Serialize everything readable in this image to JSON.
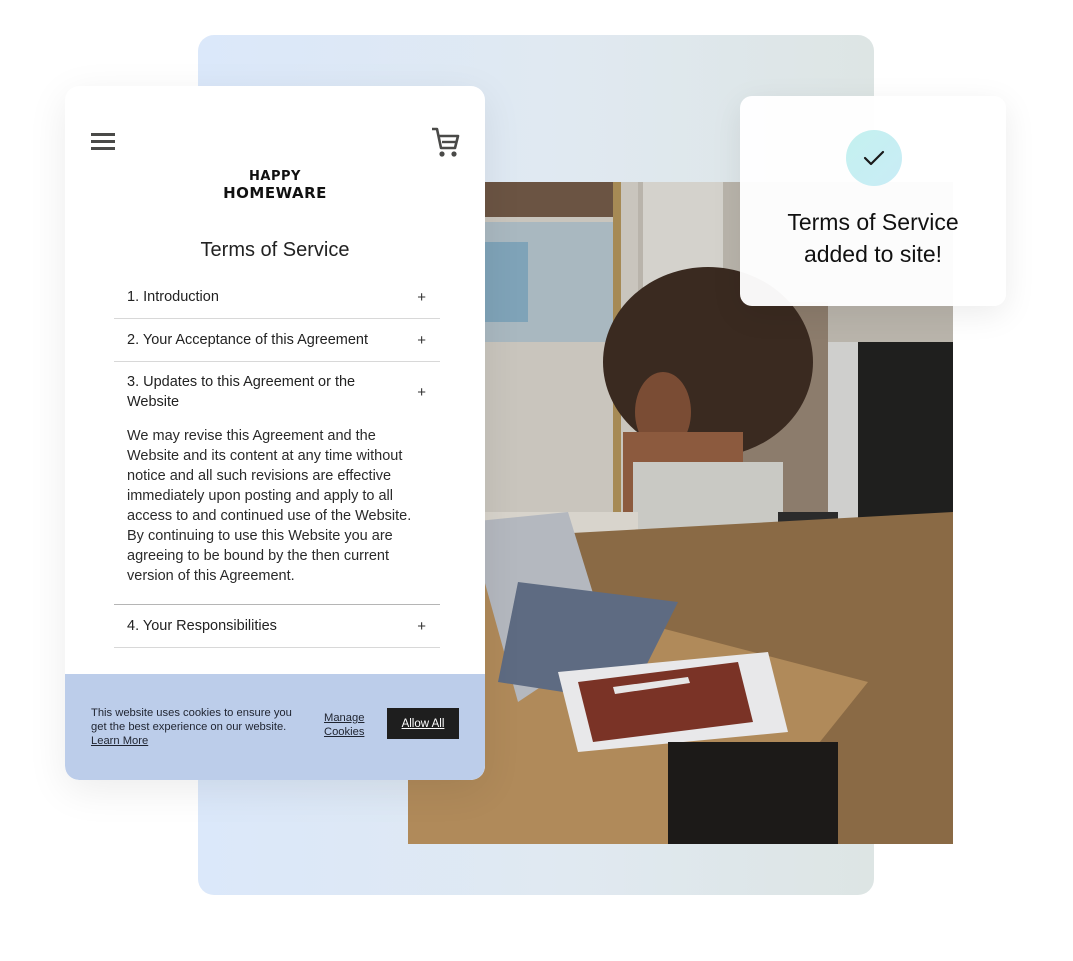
{
  "phone": {
    "menu_icon": "hamburger-menu-icon",
    "cart_icon": "shopping-cart-icon",
    "logo": {
      "line1": "Happy",
      "line2": "Homeware"
    },
    "page_title": "Terms of Service",
    "accordion": [
      {
        "title": "1. Introduction",
        "toggle": "+",
        "open": false
      },
      {
        "title": "2. Your Acceptance of this Agreement",
        "toggle": "+",
        "open": false
      },
      {
        "title": "3. Updates to this Agreement or the Website",
        "toggle": "+",
        "open": true,
        "body": "We may revise this Agreement and the Website and its content at any time without notice and all such revisions are effective immediately upon posting and apply to all access to and continued use of the Website. By continuing to use this Website you are agreeing to be bound by the then current version of this Agreement."
      },
      {
        "title": "4. Your Responsibilities",
        "toggle": "+",
        "open": false
      }
    ],
    "cookie_banner": {
      "message": "This website uses cookies to ensure you get the best experience on our website.",
      "learn_more": "Learn More",
      "manage": "Manage Cookies",
      "allow_all": "Allow All",
      "background": "#bccdea"
    }
  },
  "toast": {
    "icon": "checkmark-icon",
    "message_line1": "Terms of Service",
    "message_line2": "added to site!"
  },
  "photo": {
    "description": "Woman with curly hair sitting at a wooden desk using a laptop, with a notebook and pen"
  },
  "colors": {
    "backdrop_start": "#dbe8fa",
    "backdrop_end": "#dde5e4",
    "check_circle": "#c4f1ef",
    "button_dark": "#1e1e1e"
  }
}
